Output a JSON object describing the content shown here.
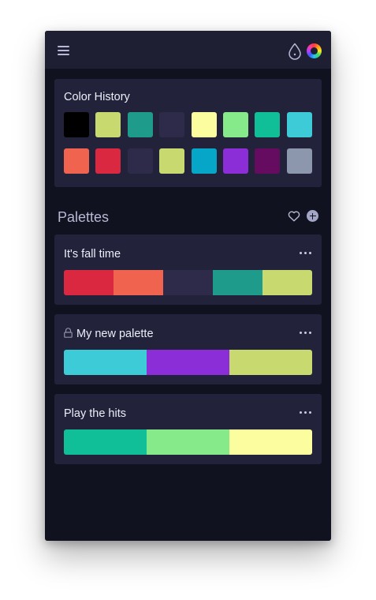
{
  "history": {
    "title": "Color History",
    "swatches": [
      "#000000",
      "#c8d96f",
      "#1e9b8a",
      "#2d2a4a",
      "#fbfd9e",
      "#86e98a",
      "#10bf97",
      "#3ccbd7",
      "#f0634e",
      "#db2841",
      "#2d2a4a",
      "#c8d96f",
      "#06a6c8",
      "#8b2ed8",
      "#650b60",
      "#8c96ac"
    ]
  },
  "palettes": {
    "title": "Palettes",
    "items": [
      {
        "name": "It's fall time",
        "locked": false,
        "colors": [
          "#db2841",
          "#f0634e",
          "#2d2a4a",
          "#1e9b8a",
          "#c8d96f"
        ]
      },
      {
        "name": "My new palette",
        "locked": true,
        "colors": [
          "#3ccbd7",
          "#8b2ed8",
          "#c8d96f"
        ]
      },
      {
        "name": "Play the hits",
        "locked": false,
        "colors": [
          "#10bf97",
          "#86e98a",
          "#fbfd9e"
        ]
      }
    ]
  },
  "icons": {
    "menu": "hamburger-menu-icon",
    "drop": "drop-icon",
    "wheel": "color-wheel-icon",
    "favorites": "heart-icon",
    "add": "add-circle-icon",
    "more": "more-dots-icon",
    "lock": "lock-icon"
  }
}
